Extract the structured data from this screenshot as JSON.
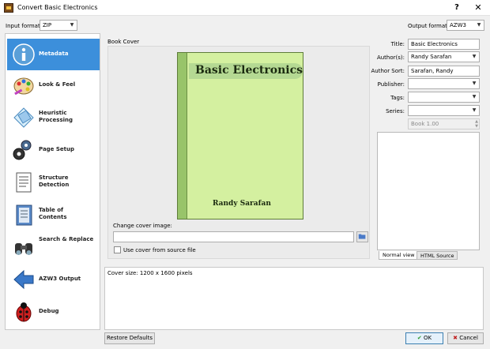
{
  "window": {
    "title": "Convert Basic Electronics",
    "help_glyph": "?",
    "close_glyph": "✕"
  },
  "formats": {
    "input_label": "Input format:",
    "input_value": "ZIP",
    "output_label": "Output format:",
    "output_value": "AZW3"
  },
  "sidebar": {
    "items": [
      {
        "label": "Metadata",
        "icon": "info-icon"
      },
      {
        "label": "Look & Feel",
        "icon": "palette-icon"
      },
      {
        "label": "Heuristic Processing",
        "icon": "diamond-icon"
      },
      {
        "label": "Page Setup",
        "icon": "gears-icon"
      },
      {
        "label": "Structure Detection",
        "icon": "document-icon"
      },
      {
        "label": "Table of Contents",
        "icon": "notebook-icon"
      },
      {
        "label": "Search & Replace",
        "icon": "binoculars-icon"
      },
      {
        "label": "AZW3 Output",
        "icon": "arrow-left-icon"
      },
      {
        "label": "Debug",
        "icon": "ladybug-icon"
      }
    ]
  },
  "cover": {
    "section_label": "Book Cover",
    "book_title": "Basic Electronics",
    "book_author": "Randy Sarafan",
    "change_label": "Change cover image:",
    "change_value": "",
    "use_source_label": "Use cover from source file"
  },
  "fields": {
    "title_label": "Title:",
    "title_value": "Basic Electronics",
    "authors_label": "Author(s):",
    "authors_value": "Randy Sarafan",
    "author_sort_label": "Author Sort:",
    "author_sort_value": "Sarafan, Randy",
    "publisher_label": "Publisher:",
    "publisher_value": "",
    "tags_label": "Tags:",
    "tags_value": "",
    "series_label": "Series:",
    "series_value": "",
    "series_index": "Book 1.00"
  },
  "comments": {
    "tab_normal": "Normal view",
    "tab_html": "HTML Source"
  },
  "log": {
    "text": "Cover size: 1200 x 1600 pixels"
  },
  "buttons": {
    "restore": "Restore Defaults",
    "ok": "OK",
    "cancel": "Cancel"
  },
  "colors": {
    "selected_nav": "#3c8fdb",
    "cover_green": "#d4f0a0"
  }
}
